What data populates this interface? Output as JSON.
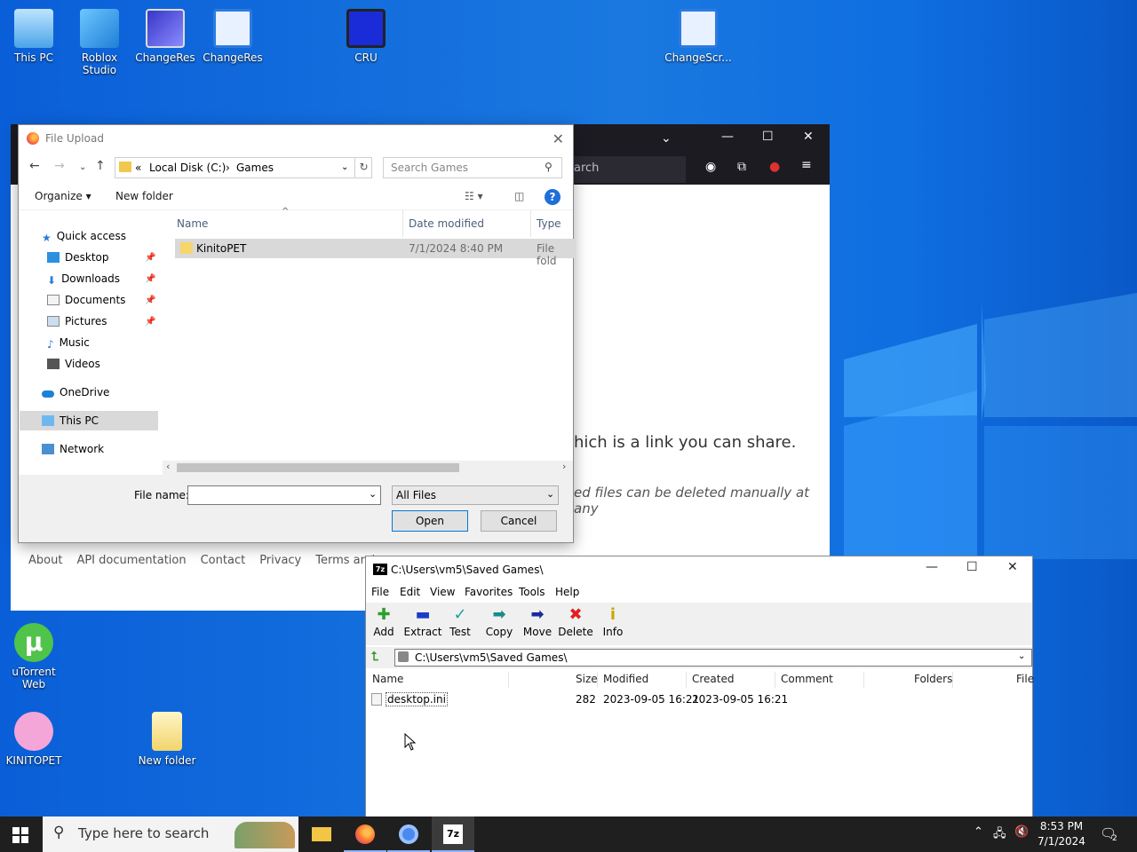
{
  "desktop": {
    "icons": [
      {
        "label": "This PC"
      },
      {
        "label": "Roblox Studio"
      },
      {
        "label": "ChangeRes"
      },
      {
        "label": "ChangeRes"
      },
      {
        "label": "CRU"
      },
      {
        "label": "ChangeScr..."
      },
      {
        "label": "uTorrent Web"
      },
      {
        "label": "KINITOPET"
      },
      {
        "label": "New folder"
      }
    ]
  },
  "browser": {
    "url_text": "arch",
    "body_line1": "hich is a link you can share.",
    "body_line2": "ed files can be deleted manually at any",
    "footer": [
      "About",
      "API documentation",
      "Contact",
      "Privacy",
      "Terms and"
    ]
  },
  "file_upload": {
    "title": "File Upload",
    "breadcrumb": [
      "«",
      "Local Disk (C:)",
      "›",
      "Games"
    ],
    "search_placeholder": "Search Games",
    "toolbar": {
      "organize": "Organize ▾",
      "new_folder": "New folder"
    },
    "nav": {
      "quick_access": "Quick access",
      "items": [
        "Desktop",
        "Downloads",
        "Documents",
        "Pictures",
        "Music",
        "Videos"
      ],
      "onedrive": "OneDrive",
      "this_pc": "This PC",
      "network": "Network"
    },
    "columns": {
      "name": "Name",
      "date": "Date modified",
      "type": "Type"
    },
    "files": [
      {
        "name": "KinitoPET",
        "date": "7/1/2024 8:40 PM",
        "type": "File fold"
      }
    ],
    "filename_label": "File name:",
    "filename_value": "",
    "filter": "All Files",
    "open_label": "Open",
    "cancel_label": "Cancel"
  },
  "sevenzip": {
    "title": "C:\\Users\\vm5\\Saved Games\\",
    "menu": [
      "File",
      "Edit",
      "View",
      "Favorites",
      "Tools",
      "Help"
    ],
    "tools": [
      "Add",
      "Extract",
      "Test",
      "Copy",
      "Move",
      "Delete",
      "Info"
    ],
    "path": "C:\\Users\\vm5\\Saved Games\\",
    "columns": [
      "Name",
      "Size",
      "Modified",
      "Created",
      "Comment",
      "Folders",
      "File"
    ],
    "rows": [
      {
        "name": "desktop.ini",
        "size": "282",
        "modified": "2023-09-05 16:21",
        "created": "2023-09-05 16:21"
      }
    ]
  },
  "taskbar": {
    "search_placeholder": "Type here to search",
    "time": "8:53 PM",
    "date": "7/1/2024",
    "notif_count": "2"
  }
}
